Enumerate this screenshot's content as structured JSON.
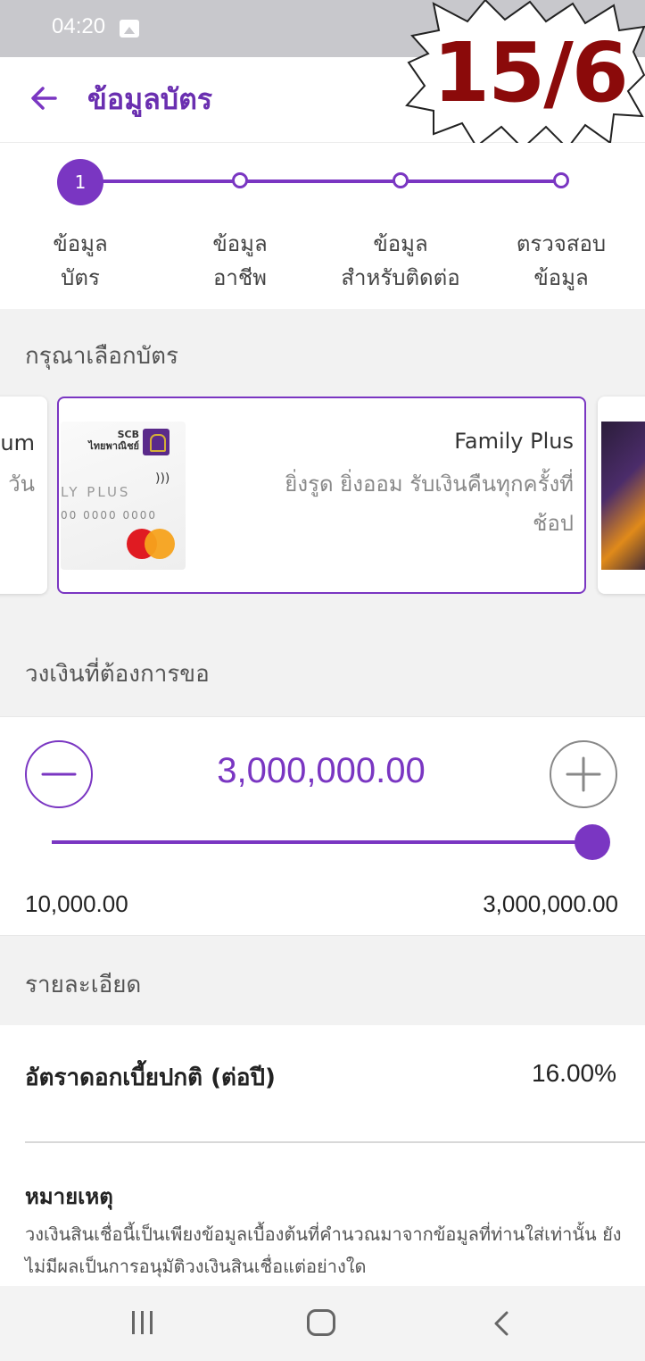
{
  "status_bar": {
    "time": "04:20",
    "image_icon": "image-icon"
  },
  "overlay_badge": {
    "text": "15/6"
  },
  "app_bar": {
    "title": "ข้อมูลบัตร",
    "back_icon": "arrow-left-icon"
  },
  "stepper": {
    "active_step_number": "1",
    "steps": [
      {
        "label": "ข้อมูล\nบัตร"
      },
      {
        "label": "ข้อมูล\nอาชีพ"
      },
      {
        "label": "ข้อมูล\nสำหรับติดต่อ"
      },
      {
        "label": "ตรวจสอบ\nข้อมูล"
      }
    ]
  },
  "card_section": {
    "heading": "กรุณาเลือกบัตร",
    "prev_card_partial": {
      "line1": "um",
      "line2": "วัน"
    },
    "selected_card": {
      "name": "Family Plus",
      "description": "ยิ่งรูด ยิ่งออม รับเงินคืนทุกครั้งที่ช้อป",
      "image": {
        "bank_name_en": "SCB",
        "bank_name_th": "ไทยพาณิชย์",
        "card_text": "LY PLUS",
        "card_number": "00 0000 0000"
      }
    }
  },
  "amount_section": {
    "heading": "วงเงินที่ต้องการขอ",
    "value": "3,000,000.00",
    "min_label": "10,000.00",
    "max_label": "3,000,000.00",
    "slider_level_percent": 100
  },
  "details_section": {
    "heading": "รายละเอียด",
    "interest_label": "อัตราดอกเบี้ยปกติ (ต่อปี)",
    "interest_value": "16.00%"
  },
  "note": {
    "title": "หมายเหตุ",
    "text": "วงเงินสินเชื่อนี้เป็นเพียงข้อมูลเบื้องต้นที่คำนวณมาจากข้อมูลที่ท่านใส่เท่านั้น ยังไม่มีผลเป็นการอนุมัติวงเงินสินเชื่อแต่อย่างใด"
  },
  "nav_bar": {
    "recents_icon": "recents-icon",
    "home_icon": "home-icon",
    "back_icon": "back-icon"
  },
  "colors": {
    "accent": "#7a36c2",
    "badge": "#8b0a0a",
    "section_bg": "#f2f2f2"
  }
}
